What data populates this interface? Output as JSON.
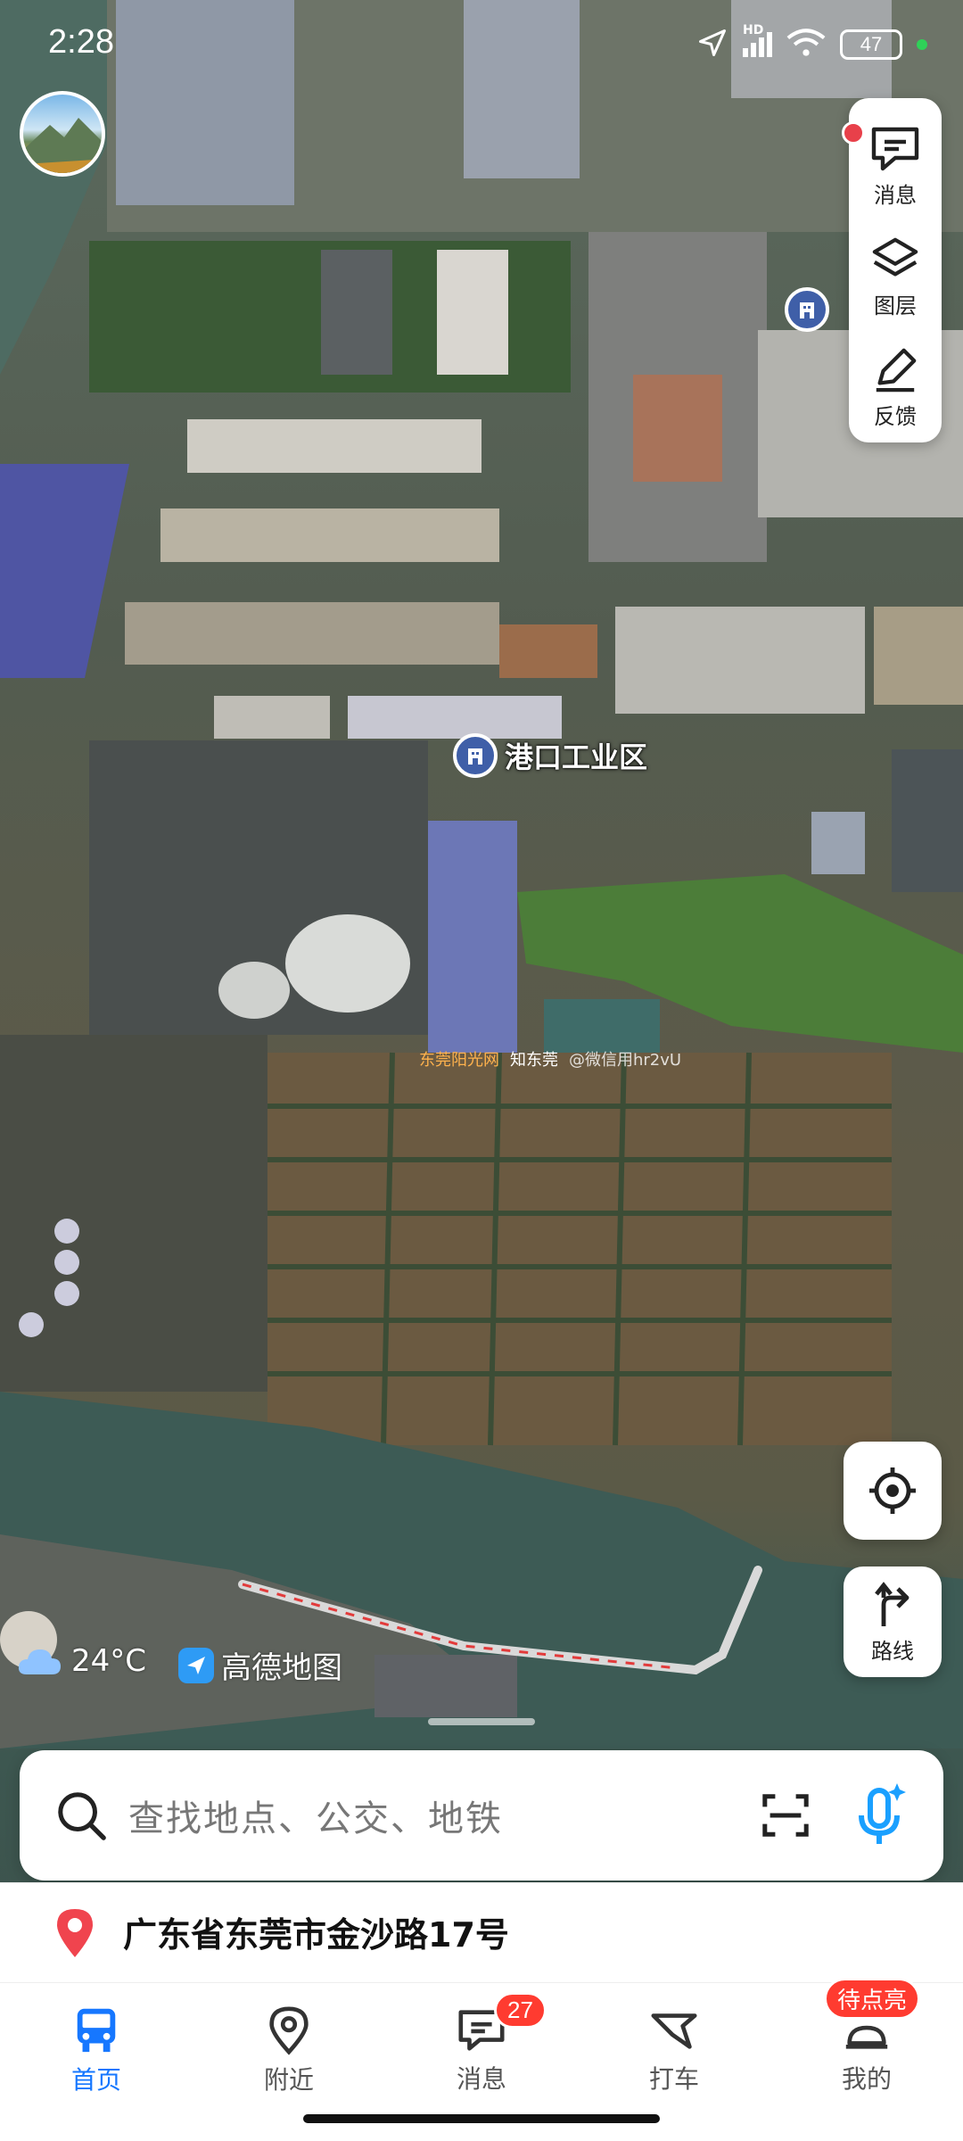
{
  "status_bar": {
    "time": "2:28",
    "network": "HD",
    "battery": "47"
  },
  "side_panel": {
    "messages_label": "消息",
    "layers_label": "图层",
    "feedback_label": "反馈"
  },
  "map": {
    "poi_main": "港口工业区",
    "watermark_site": "东莞阳光网",
    "watermark_app": "知东莞",
    "watermark_wechat": "@微信用hr2vU"
  },
  "weather": {
    "temperature": "24°C",
    "icon": "cloud-icon"
  },
  "brand": {
    "name": "高德地图"
  },
  "route_button": {
    "label": "路线"
  },
  "search": {
    "placeholder": "查找地点、公交、地铁"
  },
  "address": {
    "text": "广东省东莞市金沙路17号"
  },
  "tabs": [
    {
      "label": "首页",
      "active": true
    },
    {
      "label": "附近",
      "active": false
    },
    {
      "label": "消息",
      "active": false,
      "badge": "27"
    },
    {
      "label": "打车",
      "active": false
    },
    {
      "label": "我的",
      "active": false,
      "badge": "待点亮"
    }
  ],
  "colors": {
    "accent": "#1677ff",
    "badge": "#ff3b30",
    "poi": "#3f5fa8"
  }
}
